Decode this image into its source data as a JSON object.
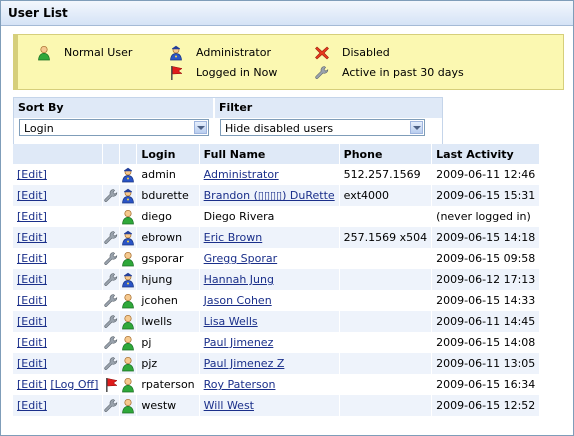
{
  "panel": {
    "title": "User List"
  },
  "legend": {
    "normal_user": "Normal User",
    "administrator": "Administrator",
    "disabled": "Disabled",
    "logged_in_now": "Logged in Now",
    "active_past_30": "Active in past 30 days"
  },
  "sort": {
    "label": "Sort By",
    "value": "Login"
  },
  "filter": {
    "label": "Filter",
    "value": "Hide disabled users"
  },
  "table": {
    "columns": [
      "Login",
      "Full Name",
      "Phone",
      "Last Activity"
    ],
    "rows": [
      {
        "actions": [
          "[Edit]"
        ],
        "active": false,
        "flag": false,
        "role": "admin",
        "login": "admin",
        "full_name": "Administrator",
        "linked": true,
        "phone": "512.257.1569",
        "last_activity": "2009-06-11 12:46"
      },
      {
        "actions": [
          "[Edit]"
        ],
        "active": true,
        "flag": false,
        "role": "admin",
        "login": "bdurette",
        "full_name": "Brandon (▯▯▯▯) DuRette",
        "linked": true,
        "phone": "ext4000",
        "last_activity": "2009-06-15 15:31"
      },
      {
        "actions": [
          "[Edit]"
        ],
        "active": false,
        "flag": false,
        "role": "normal",
        "login": "diego",
        "full_name": "Diego Rivera",
        "linked": false,
        "phone": "",
        "last_activity": "(never logged in)"
      },
      {
        "actions": [
          "[Edit]"
        ],
        "active": true,
        "flag": false,
        "role": "admin",
        "login": "ebrown",
        "full_name": "Eric Brown",
        "linked": true,
        "phone": "257.1569 x504",
        "last_activity": "2009-06-15 14:18"
      },
      {
        "actions": [
          "[Edit]"
        ],
        "active": true,
        "flag": false,
        "role": "normal",
        "login": "gsporar",
        "full_name": "Gregg Sporar",
        "linked": true,
        "phone": "",
        "last_activity": "2009-06-15 09:58"
      },
      {
        "actions": [
          "[Edit]"
        ],
        "active": true,
        "flag": false,
        "role": "admin",
        "login": "hjung",
        "full_name": "Hannah Jung",
        "linked": true,
        "phone": "",
        "last_activity": "2009-06-12 17:13"
      },
      {
        "actions": [
          "[Edit]"
        ],
        "active": true,
        "flag": false,
        "role": "normal",
        "login": "jcohen",
        "full_name": "Jason Cohen",
        "linked": true,
        "phone": "",
        "last_activity": "2009-06-15 14:33"
      },
      {
        "actions": [
          "[Edit]"
        ],
        "active": true,
        "flag": false,
        "role": "normal",
        "login": "lwells",
        "full_name": "Lisa Wells",
        "linked": true,
        "phone": "",
        "last_activity": "2009-06-11 14:45"
      },
      {
        "actions": [
          "[Edit]"
        ],
        "active": true,
        "flag": false,
        "role": "normal",
        "login": "pj",
        "full_name": "Paul Jimenez",
        "linked": true,
        "phone": "",
        "last_activity": "2009-06-15 14:08"
      },
      {
        "actions": [
          "[Edit]"
        ],
        "active": true,
        "flag": false,
        "role": "normal",
        "login": "pjz",
        "full_name": "Paul Jimenez Z",
        "linked": true,
        "phone": "",
        "last_activity": "2009-06-11 13:05"
      },
      {
        "actions": [
          "[Edit]",
          "[Log Off]"
        ],
        "active": false,
        "flag": true,
        "role": "normal",
        "login": "rpaterson",
        "full_name": "Roy Paterson",
        "linked": true,
        "phone": "",
        "last_activity": "2009-06-15 16:34"
      },
      {
        "actions": [
          "[Edit]"
        ],
        "active": true,
        "flag": false,
        "role": "normal",
        "login": "westw",
        "full_name": "Will West",
        "linked": true,
        "phone": "",
        "last_activity": "2009-06-15 12:52"
      }
    ]
  }
}
